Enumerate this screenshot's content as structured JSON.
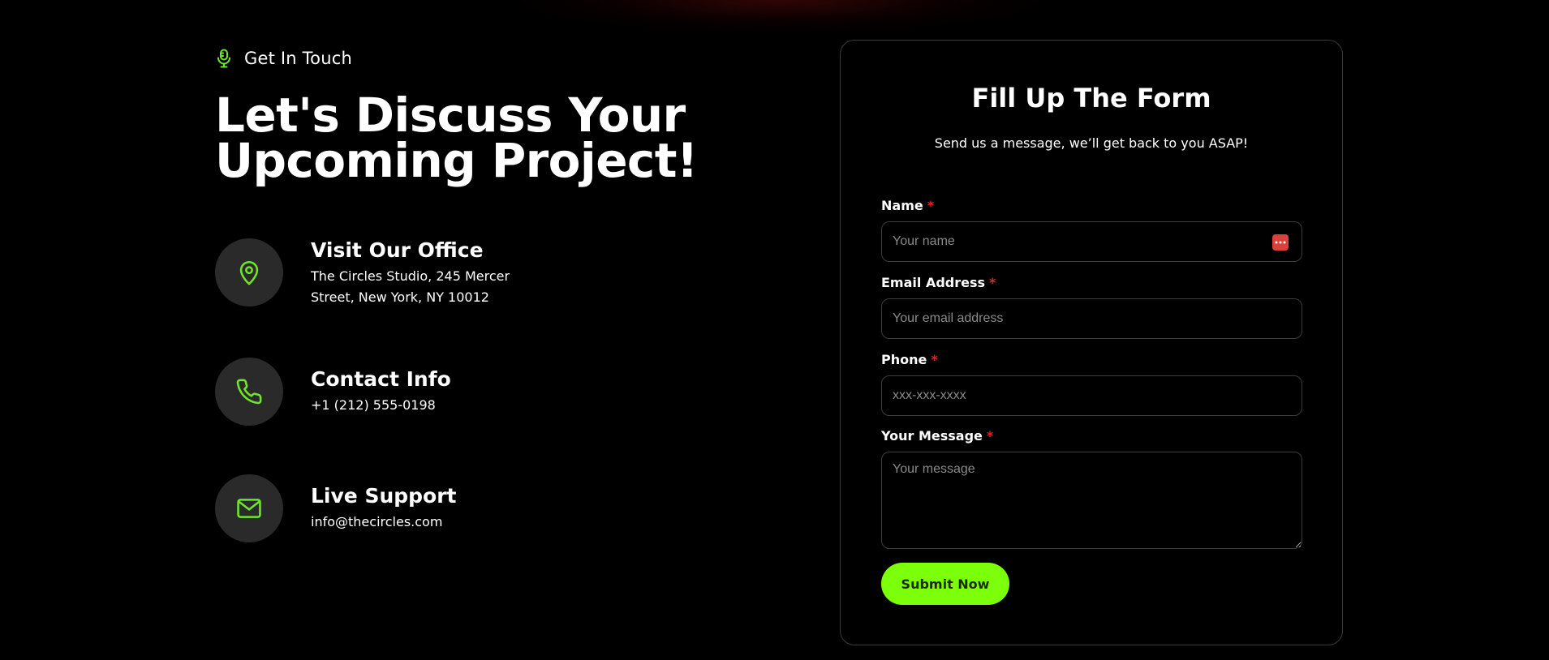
{
  "colors": {
    "background": "#000000",
    "accent_green": "#7cff0a",
    "icon_green": "#6fe62b",
    "required_red": "#e02424",
    "card_border": "#3a3a3a",
    "icon_circle": "#2a2a2a"
  },
  "intro": {
    "eyebrow": "Get In Touch",
    "eyebrow_icon": "microphone-icon",
    "headline_line1": "Let's Discuss Your",
    "headline_line2": "Upcoming Project!"
  },
  "contact_items": [
    {
      "icon": "location-pin-icon",
      "title": "Visit Our Office",
      "line1": "The Circles Studio, 245 Mercer",
      "line2": "Street, New York, NY 10012"
    },
    {
      "icon": "phone-icon",
      "title": "Contact Info",
      "line1": "+1 (212) 555-0198"
    },
    {
      "icon": "mail-icon",
      "title": "Live Support",
      "line1": "info@thecircles.com"
    }
  ],
  "form": {
    "title": "Fill Up The Form",
    "subtitle": "Send us a message, we’ll get back to you ASAP!",
    "required_marker": "*",
    "fields": {
      "name": {
        "label": "Name",
        "placeholder": "Your name",
        "value": ""
      },
      "email": {
        "label": "Email Address",
        "placeholder": "Your email address",
        "value": ""
      },
      "phone": {
        "label": "Phone",
        "placeholder": "xxx-xxx-xxxx",
        "value": ""
      },
      "message": {
        "label": "Your Message",
        "placeholder": "Your message",
        "value": ""
      }
    },
    "submit_label": "Submit Now"
  }
}
